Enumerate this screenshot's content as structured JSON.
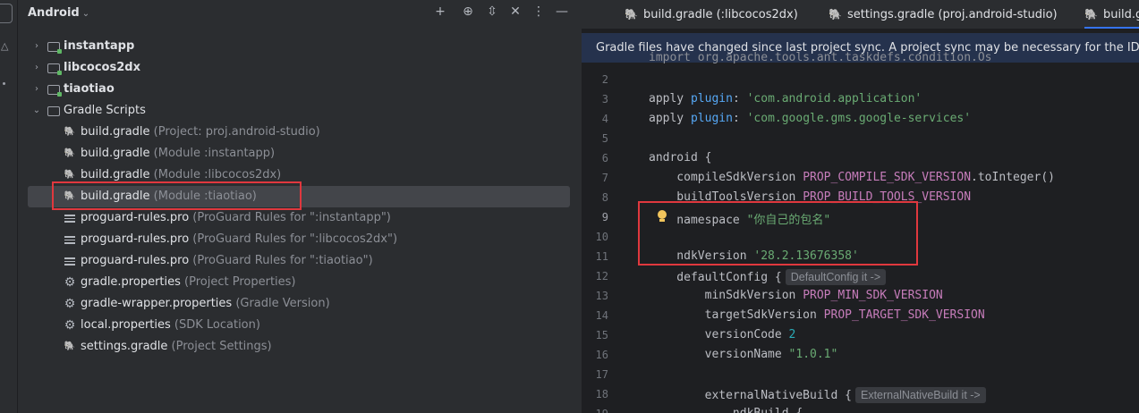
{
  "project_panel": {
    "view_selector": "Android",
    "tree": [
      {
        "label": "instantapp",
        "hint": "",
        "bold": true,
        "icon": "module-folder-icon",
        "arrow": "›"
      },
      {
        "label": "libcocos2dx",
        "hint": "",
        "bold": true,
        "icon": "module-folder-icon",
        "arrow": "›"
      },
      {
        "label": "tiaotiao",
        "hint": "",
        "bold": true,
        "icon": "module-folder-icon",
        "arrow": "›"
      },
      {
        "label": "Gradle Scripts",
        "hint": "",
        "bold": false,
        "icon": "gradle-folder-icon",
        "arrow": "⌄"
      },
      {
        "label": "build.gradle",
        "hint": "(Project: proj.android-studio)",
        "icon": "gradle-elephant-icon"
      },
      {
        "label": "build.gradle",
        "hint": "(Module :instantapp)",
        "icon": "gradle-elephant-icon"
      },
      {
        "label": "build.gradle",
        "hint": "(Module :libcocos2dx)",
        "icon": "gradle-elephant-icon"
      },
      {
        "label": "build.gradle",
        "hint": "(Module :tiaotiao)",
        "icon": "gradle-elephant-icon",
        "selected": true
      },
      {
        "label": "proguard-rules.pro",
        "hint": "(ProGuard Rules for \":instantapp\")",
        "icon": "text-file-icon"
      },
      {
        "label": "proguard-rules.pro",
        "hint": "(ProGuard Rules for \":libcocos2dx\")",
        "icon": "text-file-icon"
      },
      {
        "label": "proguard-rules.pro",
        "hint": "(ProGuard Rules for \":tiaotiao\")",
        "icon": "text-file-icon"
      },
      {
        "label": "gradle.properties",
        "hint": "(Project Properties)",
        "icon": "settings-file-icon"
      },
      {
        "label": "gradle-wrapper.properties",
        "hint": "(Gradle Version)",
        "icon": "settings-file-icon"
      },
      {
        "label": "local.properties",
        "hint": "(SDK Location)",
        "icon": "settings-file-icon"
      },
      {
        "label": "settings.gradle",
        "hint": "(Project Settings)",
        "icon": "gradle-elephant-icon"
      }
    ]
  },
  "tabs": [
    {
      "label": "build.gradle (:libcocos2dx)"
    },
    {
      "label": "settings.gradle (proj.android-studio)"
    },
    {
      "label": "build.g"
    }
  ],
  "banner": "Gradle files have changed since last project sync. A project sync may be necessary for the IDE to w",
  "code": {
    "line1_partial": "import org.apache.tools.ant.taskdefs.condition.Os",
    "lines": [
      {
        "n": "2",
        "parts": []
      },
      {
        "n": "3",
        "parts": [
          [
            "kw",
            "apply "
          ],
          [
            "m",
            "plugin"
          ],
          [
            "kw",
            ": "
          ],
          [
            "str",
            "'com.android.application'"
          ]
        ]
      },
      {
        "n": "4",
        "parts": [
          [
            "kw",
            "apply "
          ],
          [
            "m",
            "plugin"
          ],
          [
            "kw",
            ": "
          ],
          [
            "str",
            "'com.google.gms.google-services'"
          ]
        ]
      },
      {
        "n": "5",
        "parts": []
      },
      {
        "n": "6",
        "parts": [
          [
            "kw",
            "android {"
          ]
        ]
      },
      {
        "n": "7",
        "parts": [
          [
            "kw",
            "    compileSdkVersion "
          ],
          [
            "pp",
            "PROP_COMPILE_SDK_VERSION"
          ],
          [
            "kw",
            "."
          ],
          [
            "fn",
            "toInteger"
          ],
          [
            "kw",
            "()"
          ]
        ]
      },
      {
        "n": "8",
        "parts": [
          [
            "kw",
            "    buildToolsVersion "
          ],
          [
            "pp",
            "PROP_BUILD_TOOLS_VERSION"
          ]
        ]
      },
      {
        "n": "9",
        "parts": [
          [
            "kw",
            "    namespace "
          ],
          [
            "str",
            "\"你自己的包名\""
          ]
        ]
      },
      {
        "n": "10",
        "parts": []
      },
      {
        "n": "11",
        "parts": [
          [
            "kw",
            "    ndkVersion "
          ],
          [
            "str",
            "'28.2.13676358'"
          ]
        ]
      },
      {
        "n": "12",
        "parts": [
          [
            "kw",
            "    defaultConfig {"
          ]
        ],
        "inlay": "DefaultConfig it ->"
      },
      {
        "n": "13",
        "parts": [
          [
            "kw",
            "        minSdkVersion "
          ],
          [
            "pp",
            "PROP_MIN_SDK_VERSION"
          ]
        ]
      },
      {
        "n": "14",
        "parts": [
          [
            "kw",
            "        targetSdkVersion "
          ],
          [
            "pp",
            "PROP_TARGET_SDK_VERSION"
          ]
        ]
      },
      {
        "n": "15",
        "parts": [
          [
            "kw",
            "        versionCode "
          ],
          [
            "num",
            "2"
          ]
        ]
      },
      {
        "n": "16",
        "parts": [
          [
            "kw",
            "        versionName "
          ],
          [
            "str",
            "\"1.0.1\""
          ]
        ]
      },
      {
        "n": "17",
        "parts": []
      },
      {
        "n": "18",
        "parts": [
          [
            "kw",
            "        externalNativeBuild {"
          ]
        ],
        "inlay": "ExternalNativeBuild it ->"
      },
      {
        "n": "19",
        "parts": [
          [
            "kw",
            "            ndkBuild {"
          ]
        ]
      }
    ]
  }
}
